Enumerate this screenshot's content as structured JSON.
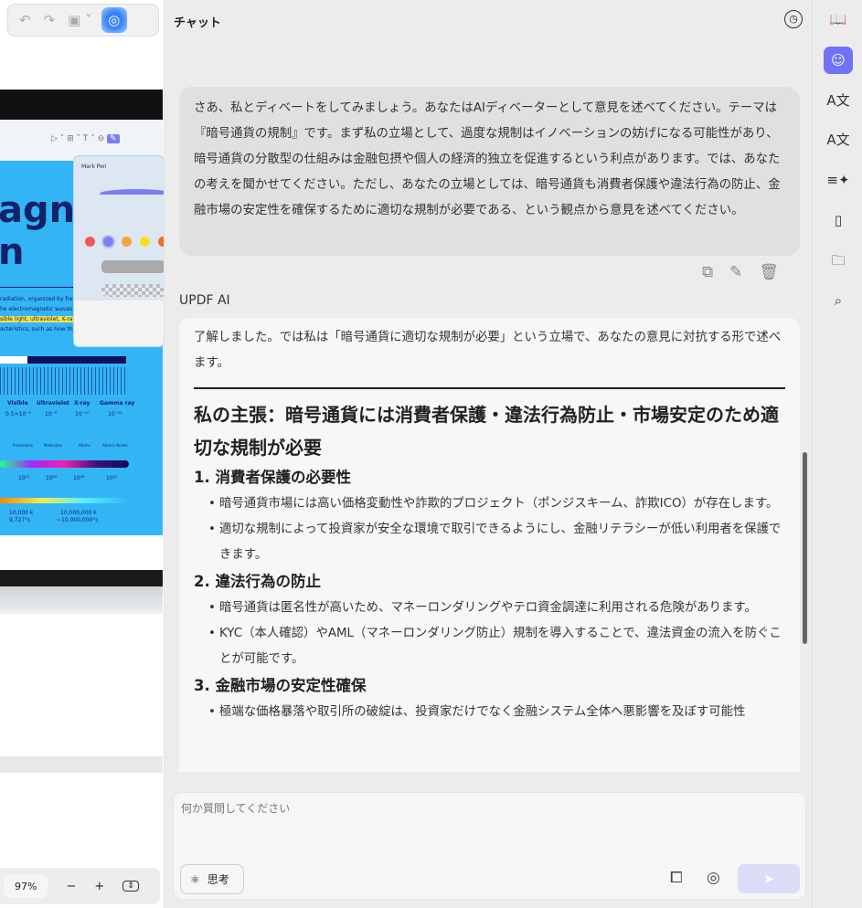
{
  "toolbar": {
    "undo": "undo-icon",
    "redo": "redo-icon",
    "save": "save-icon",
    "ai": "ai-assistant-icon"
  },
  "document": {
    "heading_fragment_1": "agne",
    "heading_fragment_2": "n",
    "text_lines": [
      "radiation, organized by frequ",
      "he electromagnetic waves w",
      "sible light, ultraviolet, X-rays,",
      "acteristics, such as how they"
    ],
    "bands": [
      "Visible",
      "Ultraviolet",
      "X-ray",
      "Gamma ray"
    ],
    "wavelengths": [
      "0.5×10⁻⁶",
      "10⁻⁸",
      "10⁻¹⁰",
      "10⁻¹²"
    ],
    "objects": [
      "Protozoans",
      "Molecules",
      "Atoms",
      "Atomic Nuclei"
    ],
    "frequencies": [
      "10¹⁵",
      "10¹⁶",
      "10¹⁸",
      "10²⁰"
    ],
    "temps": [
      "10,000 k",
      "9,727°c",
      "10,000,000 k",
      "~10,000,000°c"
    ],
    "mark_pen_title": "Mark Pen",
    "pen_colors": [
      "#f25757",
      "#7b7ff5",
      "#f7a23a",
      "#f7e02a",
      "#f26b2a"
    ]
  },
  "zoom": {
    "value": "97%",
    "minus": "−",
    "plus": "+"
  },
  "chat": {
    "title": "チャット",
    "user_message": "さあ、私とディベートをしてみましょう。あなたはAIディベーターとして意見を述べてください。テーマは『暗号通貨の規制』です。まず私の立場として、過度な規制はイノベーションの妨げになる可能性があり、暗号通貨の分散型の仕組みは金融包摂や個人の経済的独立を促進するという利点があります。では、あなたの考えを聞かせてください。ただし、あなたの立場としては、暗号通貨も消費者保護や違法行為の防止、金融市場の安定性を確保するために適切な規制が必要である、という観点から意見を述べてください。",
    "ai_name": "UPDF AI",
    "ai_intro": "了解しました。では私は「暗号通貨に適切な規制が必要」という立場で、あなたの意見に対抗する形で述べます。",
    "ai_heading": "私の主張：暗号通貨には消費者保護・違法行為防止・市場安定のため適切な規制が必要",
    "sections": [
      {
        "title": "1. 消費者保護の必要性",
        "bullets": [
          "暗号通貨市場には高い価格変動性や詐欺的プロジェクト（ポンジスキーム、詐欺ICO）が存在します。",
          "適切な規制によって投資家が安全な環境で取引できるようにし、金融リテラシーが低い利用者を保護できます。"
        ]
      },
      {
        "title": "2. 違法行為の防止",
        "bullets": [
          "暗号通貨は匿名性が高いため、マネーロンダリングやテロ資金調達に利用される危険があります。",
          "KYC（本人確認）やAML（マネーロンダリング防止）規制を導入することで、違法資金の流入を防ぐことが可能です。"
        ]
      },
      {
        "title": "3. 金融市場の安定性確保",
        "bullets": [
          "極端な価格暴落や取引所の破綻は、投資家だけでなく金融システム全体へ悪影響を及ぼす可能性"
        ]
      }
    ],
    "input_placeholder": "何か質問してください",
    "think_label": "思考"
  },
  "accent": "#7073f5"
}
